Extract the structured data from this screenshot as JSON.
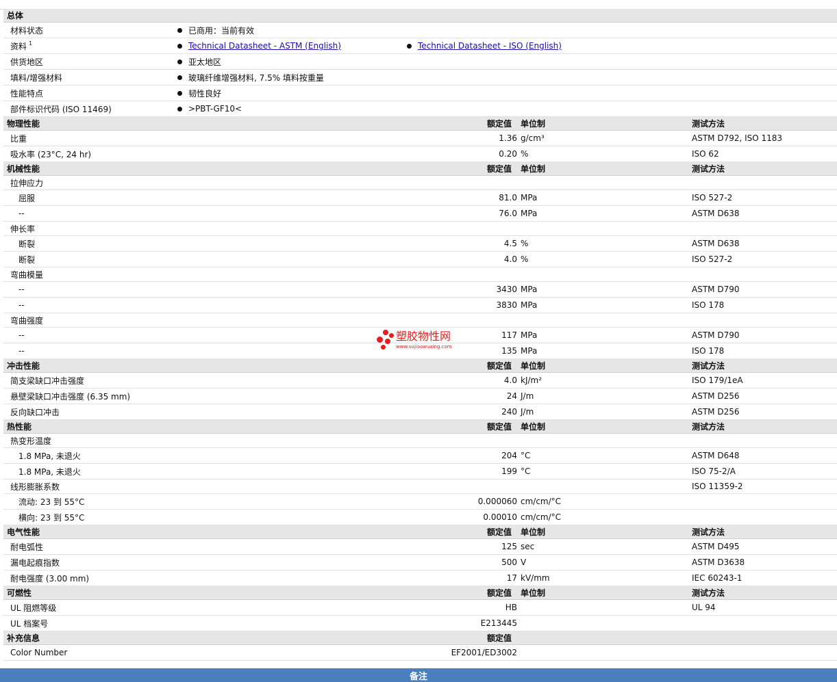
{
  "general": {
    "title": "总体",
    "rows": [
      {
        "name": "材料状态",
        "items": [
          {
            "text": "已商用：当前有效"
          }
        ]
      },
      {
        "name": "资料",
        "sup": "1",
        "items": [
          {
            "text": "Technical Datasheet - ASTM (English)",
            "link": true
          },
          {
            "text": "Technical Datasheet - ISO (English)",
            "link": true
          }
        ]
      },
      {
        "name": "供货地区",
        "items": [
          {
            "text": "亚太地区"
          }
        ]
      },
      {
        "name": "填料/增强材料",
        "items": [
          {
            "text": "玻璃纤维增强材料, 7.5% 填料按重量"
          }
        ]
      },
      {
        "name": "性能特点",
        "items": [
          {
            "text": "韧性良好"
          }
        ]
      },
      {
        "name": "部件标识代码  (ISO 11469)",
        "items": [
          {
            "text": ">PBT-GF10<"
          }
        ]
      }
    ]
  },
  "headers": {
    "nominal": "额定值",
    "unit": "单位制",
    "method": "测试方法"
  },
  "sections": [
    {
      "title": "物理性能",
      "rows": [
        {
          "name": "比重",
          "value": "1.36",
          "unit": "g/cm³",
          "method": "ASTM D792, ISO 1183"
        },
        {
          "name": "吸水率  (23°C, 24 hr)",
          "value": "0.20",
          "unit": "%",
          "method": "ISO 62"
        }
      ]
    },
    {
      "title": "机械性能",
      "rows": [
        {
          "name": "拉伸应力",
          "group": true
        },
        {
          "name": "屈服",
          "sub": true,
          "value": "81.0",
          "unit": "MPa",
          "method": "ISO 527-2"
        },
        {
          "name": "--",
          "sub": true,
          "value": "76.0",
          "unit": "MPa",
          "method": "ASTM D638"
        },
        {
          "name": "伸长率",
          "group": true
        },
        {
          "name": "断裂",
          "sub": true,
          "value": "4.5",
          "unit": "%",
          "method": "ASTM D638"
        },
        {
          "name": "断裂",
          "sub": true,
          "value": "4.0",
          "unit": "%",
          "method": "ISO 527-2"
        },
        {
          "name": "弯曲模量",
          "group": true
        },
        {
          "name": "--",
          "sub": true,
          "value": "3430",
          "unit": "MPa",
          "method": "ASTM D790"
        },
        {
          "name": "--",
          "sub": true,
          "value": "3830",
          "unit": "MPa",
          "method": "ISO 178"
        },
        {
          "name": "弯曲强度",
          "group": true
        },
        {
          "name": "--",
          "sub": true,
          "value": "117",
          "unit": "MPa",
          "method": "ASTM D790"
        },
        {
          "name": "--",
          "sub": true,
          "value": "135",
          "unit": "MPa",
          "method": "ISO 178"
        }
      ]
    },
    {
      "title": "冲击性能",
      "rows": [
        {
          "name": "简支梁缺口冲击强度",
          "value": "4.0",
          "unit": "kJ/m²",
          "method": "ISO 179/1eA"
        },
        {
          "name": "悬壁梁缺口冲击强度  (6.35 mm)",
          "value": "24",
          "unit": "J/m",
          "method": "ASTM D256"
        },
        {
          "name": "反向缺口冲击",
          "value": "240",
          "unit": "J/m",
          "method": "ASTM D256"
        }
      ]
    },
    {
      "title": "热性能",
      "rows": [
        {
          "name": "热变形温度",
          "group": true
        },
        {
          "name": "1.8 MPa, 未退火",
          "sub": true,
          "value": "204",
          "unit": "°C",
          "method": "ASTM D648"
        },
        {
          "name": "1.8 MPa, 未退火",
          "sub": true,
          "value": "199",
          "unit": "°C",
          "method": "ISO 75-2/A"
        },
        {
          "name": "线形膨胀系数",
          "group": true,
          "method": "ISO 11359-2"
        },
        {
          "name": "流动: 23 到  55°C",
          "sub": true,
          "value": "0.000060",
          "unit": "cm/cm/°C"
        },
        {
          "name": "横向: 23 到  55°C",
          "sub": true,
          "value": "0.00010",
          "unit": "cm/cm/°C"
        }
      ]
    },
    {
      "title": "电气性能",
      "rows": [
        {
          "name": "耐电弧性",
          "value": "125",
          "unit": "sec",
          "method": "ASTM D495"
        },
        {
          "name": "漏电起痕指数",
          "value": "500",
          "unit": "V",
          "method": "ASTM D3638"
        },
        {
          "name": "耐电强度  (3.00 mm)",
          "value": "17",
          "unit": "kV/mm",
          "method": "IEC 60243-1"
        }
      ]
    },
    {
      "title": "可燃性",
      "rows": [
        {
          "name": "UL 阻燃等级",
          "value": "HB",
          "method": "UL 94"
        },
        {
          "name": "UL 档案号",
          "value": "E213445"
        }
      ]
    },
    {
      "title": "补充信息",
      "nominal_only": true,
      "rows": [
        {
          "name": "Color Number",
          "value": "EF2001/ED3002"
        }
      ]
    }
  ],
  "note_bar": {
    "label": "备注"
  },
  "watermark": {
    "text": "塑胶物性网",
    "url": "www.sujiaowuxing.com"
  },
  "colors": {
    "section_bg": "#e6e6e6",
    "link": "#1a0dab",
    "note_bar": "#4a7ebd",
    "watermark": "#e02020"
  }
}
